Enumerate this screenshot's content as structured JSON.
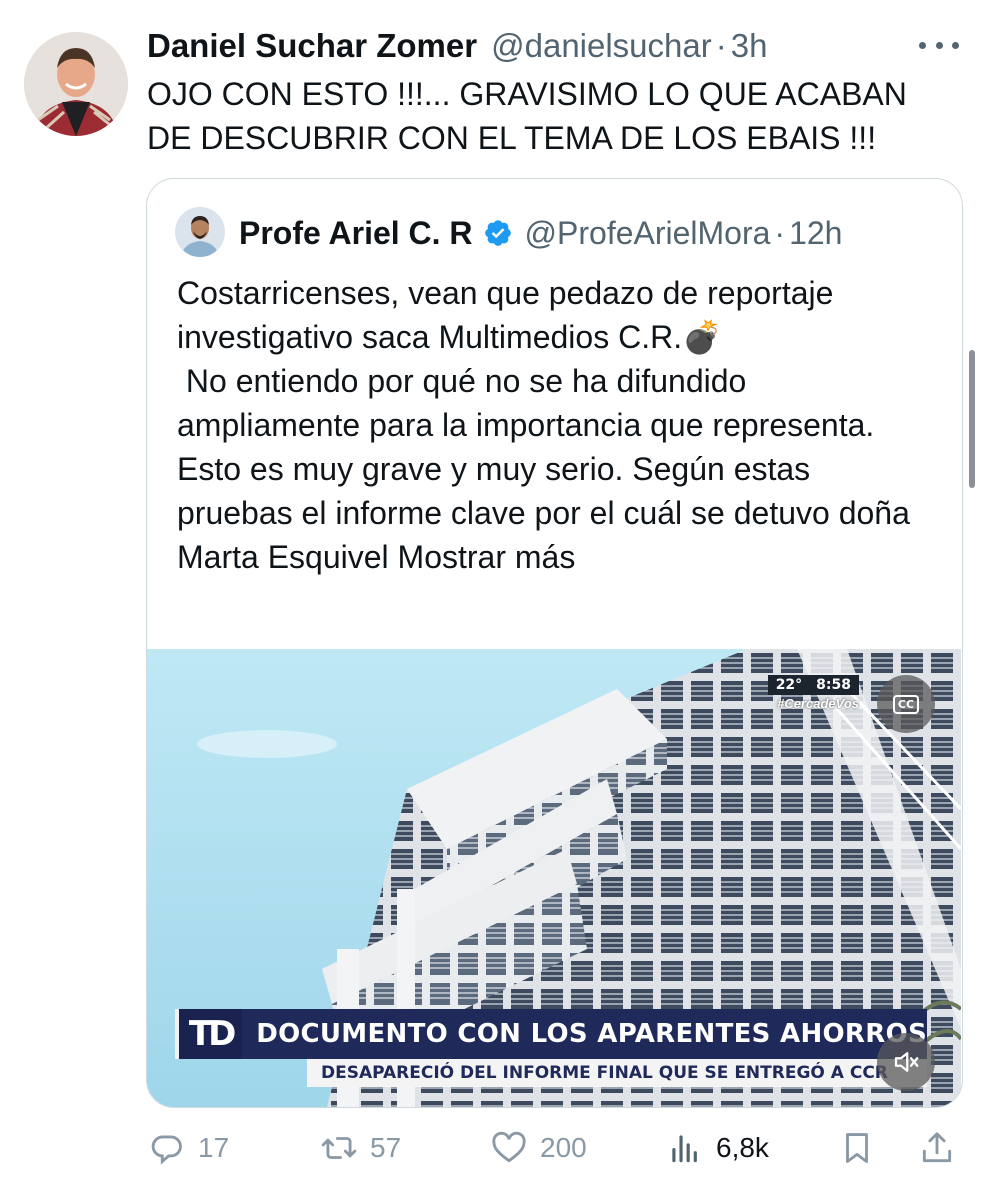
{
  "tweet": {
    "author_name": "Daniel Suchar Zomer",
    "author_handle": "@danielsuchar",
    "separator": "·",
    "time": "3h",
    "text": "OJO CON ESTO !!!... GRAVISIMO LO QUE ACABAN DE DESCUBRIR CON EL TEMA DE LOS EBAIS !!!"
  },
  "quoted": {
    "author_name": "Profe Ariel C. R",
    "author_handle": "@ProfeArielMora",
    "separator": "·",
    "time": "12h",
    "verified": true,
    "text": "Costarricenses, vean que pedazo de reportaje investigativo saca Multimedios C.R.💣\n No entiendo por qué no se ha difundido ampliamente para la importancia que representa. Esto es muy grave y muy serio. Según estas pruebas el informe clave por el cuál se detuvo doña Marta Esquivel ",
    "show_more": "Mostrar más",
    "video": {
      "temperature": "22°",
      "clock": "8:58",
      "hashtag": "#CercadeVos",
      "cc_label": "CC",
      "channel_logo": "TD",
      "headline": "DOCUMENTO CON LOS APARENTES AHORROS",
      "subheadline": "DESAPARECIÓ DEL INFORME FINAL QUE SE ENTREGÓ A CCR"
    }
  },
  "actions": {
    "reply_count": "17",
    "retweet_count": "57",
    "like_count": "200",
    "views_count": "6,8k"
  },
  "colors": {
    "text_primary": "#0f1419",
    "text_secondary": "#536471",
    "verified_blue": "#1d9bf0",
    "border": "#cfd9de",
    "lower_third_navy": "#1f2a5a"
  },
  "icons": [
    "more-icon",
    "verified-icon",
    "cc-icon",
    "mute-icon",
    "reply-icon",
    "retweet-icon",
    "like-icon",
    "views-icon",
    "bookmark-icon",
    "share-icon"
  ]
}
